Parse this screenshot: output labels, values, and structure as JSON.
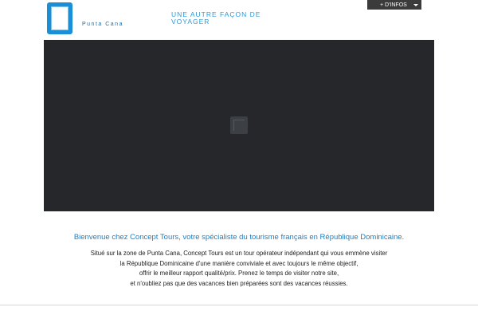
{
  "header": {
    "logo_text": "Punta Cana",
    "tagline": "UNE AUTRE FAÇON DE VOYAGER",
    "infos_button": "+ D'INFOS",
    "infos_caret_icon": "caret-down",
    "brand_color": "#1b8fd6"
  },
  "video": {
    "play_icon": "play-icon",
    "background_color": "#25272b"
  },
  "content": {
    "welcome": "Bienvenue chez Concept Tours, votre spécialiste du tourisme français en République Dominicaine.",
    "description_lines": [
      "Situé sur la zone de Punta Cana, Concept Tours est un tour opérateur indépendant qui vous emmène visiter",
      "la République Dominicaine d'une manière conviviale et avec toujours le même objectif,",
      "offrir le meilleur rapport qualité/prix. Prenez le temps de visiter notre site,",
      "et n'oubliez pas que des vacances bien préparées sont des vacances réussies."
    ]
  }
}
